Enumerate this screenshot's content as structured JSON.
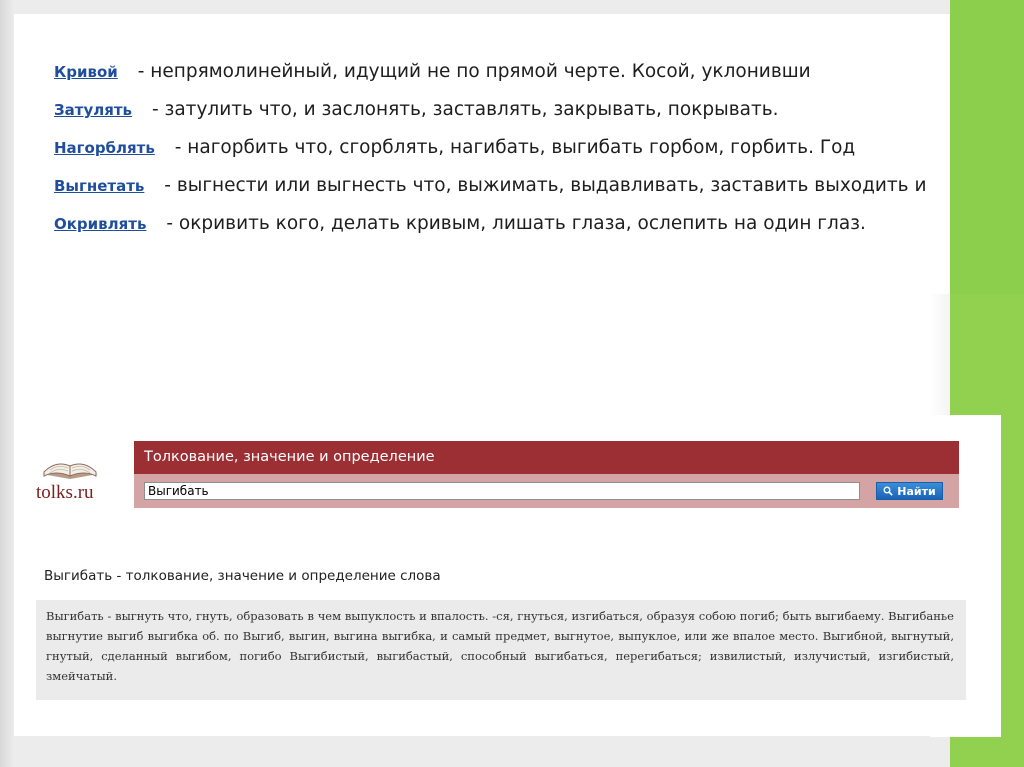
{
  "definitions": [
    {
      "term": "Кривой",
      "text": "- непрямолинейный, идущий не по прямой черте. Косой, уклонивши"
    },
    {
      "term": "Затулять",
      "text": "- затулить что, и заслонять, заставлять, закрывать, покрывать."
    },
    {
      "term": "Нагорблять",
      "text": "- нагорбить что, сгорблять, нагибать, выгибать горбом, горбить. Год"
    },
    {
      "term": "Выгнетать",
      "text": "- выгнести или выгнесть что, выжимать, выдавливать, заставить выходить и"
    },
    {
      "term": "Окривлять",
      "text": "- окривить кого, делать кривым, лишать глаза, ослепить на один глаз."
    }
  ],
  "logo": {
    "text": "tolks.ru",
    "icon": "book-icon"
  },
  "search": {
    "header": "Толкование, значение и определение",
    "value": "Выгибать",
    "button_label": "Найти",
    "button_icon": "magnifier-icon"
  },
  "result": {
    "title": "Выгибать - толкование, значение и определение слова",
    "text": "Выгибать - выгнуть что, гнуть, образовать в чем выпуклость и впалость. -ся, гнуться, изгибаться, образуя собою погиб; быть выгибаему. Выгибанье выгнутие выгиб выгибка об. по Выгиб, выгин, выгина выгибка, и самый предмет, выгнутое, выпуклое, или же впалое место. Выгибной, выгнутый, гнутый, сделанный выгибом, погибо Выгибистый, выгибастый, способный выгибаться, перегибаться; извилистый, излучистый, изгибистый, змейчатый."
  },
  "colors": {
    "accent_green": "#92d050",
    "header_red": "#9b2f33",
    "bar_pink": "#d4a3a4",
    "link_blue": "#1f4e9c",
    "button_blue": "#1a63b8"
  }
}
